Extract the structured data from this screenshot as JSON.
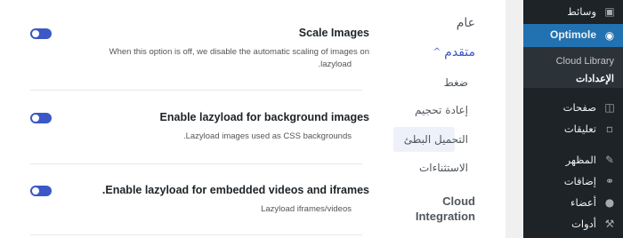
{
  "settings": [
    {
      "title": "Scale Images",
      "desc_line1": "When this option is off, we disable the automatic scaling of images on",
      "desc_line2": ".lazyload"
    },
    {
      "title": "Enable lazyload for background images",
      "desc_line1": ".Lazyload images used as CSS backgrounds",
      "desc_line2": ""
    },
    {
      "title": ".Enable lazyload for embedded videos and iframes",
      "desc_line1": "Lazyload iframes/videos",
      "desc_line2": ""
    }
  ],
  "nav": {
    "general": "عام",
    "advanced": "متقدم",
    "compression": "ضغط",
    "resize": "إعادة تحجيم",
    "lazyload": "التحميل البطئ",
    "exclusions": "الاستثناءات",
    "cloud_line1": "Cloud",
    "cloud_line2": "Integration"
  },
  "sidebar": {
    "media": "وسائط",
    "optimole": "Optimole",
    "cloud_library": "Cloud Library",
    "settings": "الإعدادات",
    "pages": "صفحات",
    "comments": "تعليقات",
    "appearance": "المظهر",
    "plugins": "إضافات",
    "users": "أعضاء",
    "tools": "أدوات"
  },
  "colors": {
    "accent": "#3b58c6",
    "sidebar_bg": "#1d2327",
    "sidebar_active": "#2271b1"
  }
}
